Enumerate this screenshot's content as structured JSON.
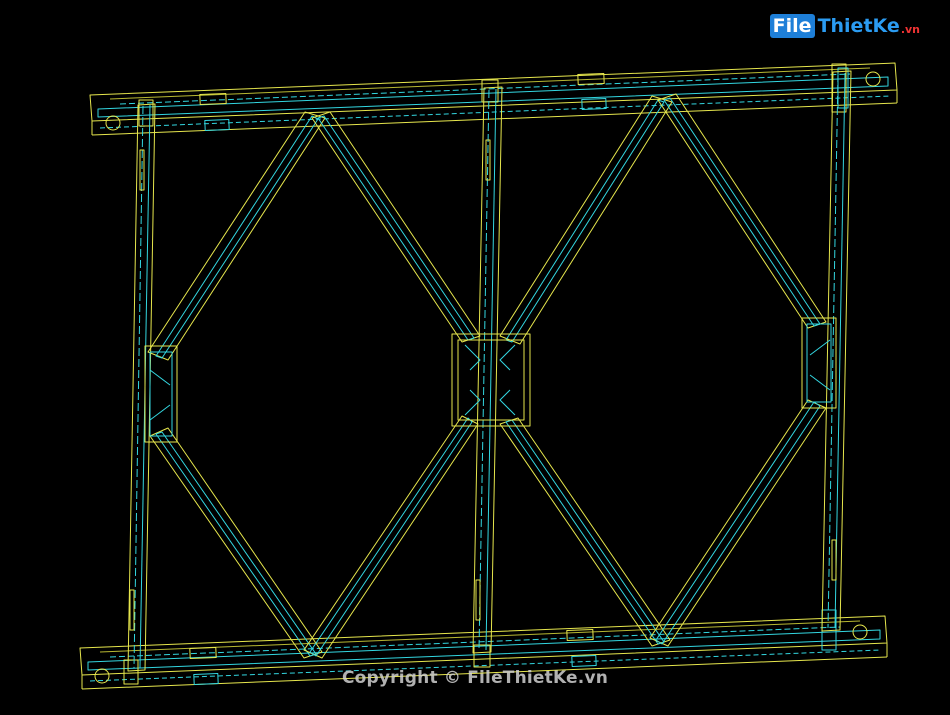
{
  "watermark": {
    "logo_file": "File",
    "logo_thietke": "ThietKe",
    "logo_tld": ".vn",
    "copyright": "Copyright © FileThietKe.vn"
  },
  "colors": {
    "background": "#000000",
    "line_yellow": "#e6e64d",
    "line_cyan": "#33d6e0",
    "line_yellow_dim": "#b8b832",
    "line_cyan_dim": "#1ea7b3"
  },
  "drawing": {
    "icons": [
      "truss-panel-drawing",
      "bolt-hole-icon",
      "gusset-plate-icon"
    ]
  }
}
